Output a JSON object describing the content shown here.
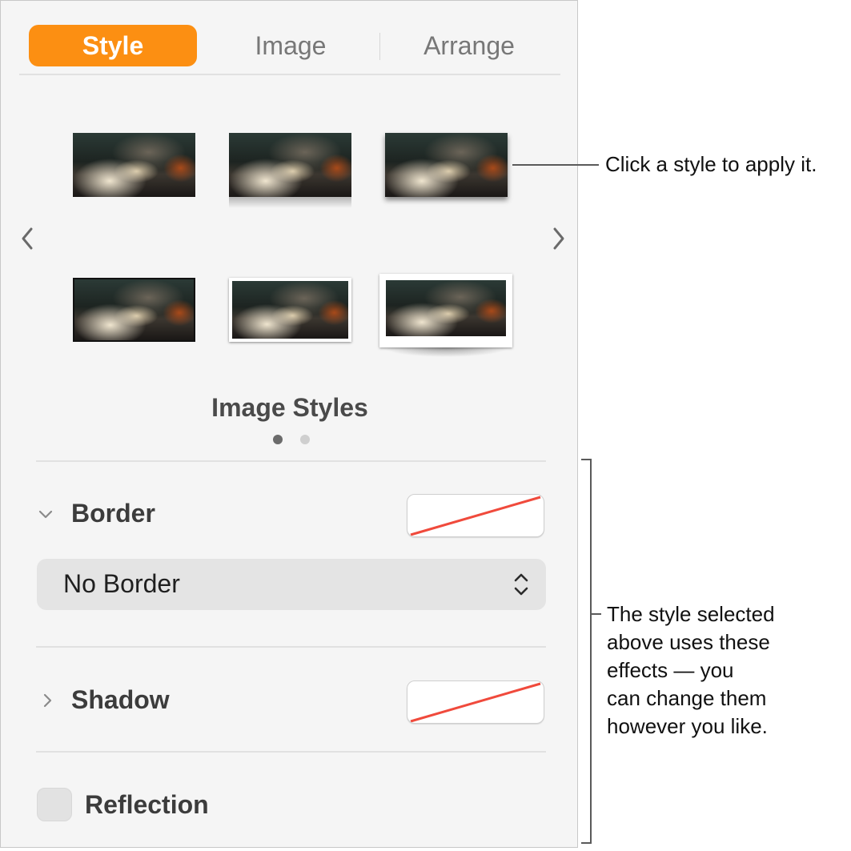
{
  "tabs": [
    {
      "label": "Style",
      "active": true
    },
    {
      "label": "Image",
      "active": false
    },
    {
      "label": "Arrange",
      "active": false
    }
  ],
  "styles_section": {
    "title": "Image Styles",
    "current_page": 1,
    "page_count": 2
  },
  "border": {
    "label": "Border",
    "expanded": true,
    "style_value": "No Border"
  },
  "shadow": {
    "label": "Shadow",
    "expanded": false
  },
  "reflection": {
    "label": "Reflection",
    "checked": false
  },
  "callouts": {
    "style_hint": "Click a style to apply it.",
    "effects_hint": [
      "The style selected",
      "above uses these",
      "effects — you",
      "can change them",
      "however you like."
    ]
  },
  "colors": {
    "accent": "#fc8f12",
    "none_stroke": "#f04a3c"
  }
}
